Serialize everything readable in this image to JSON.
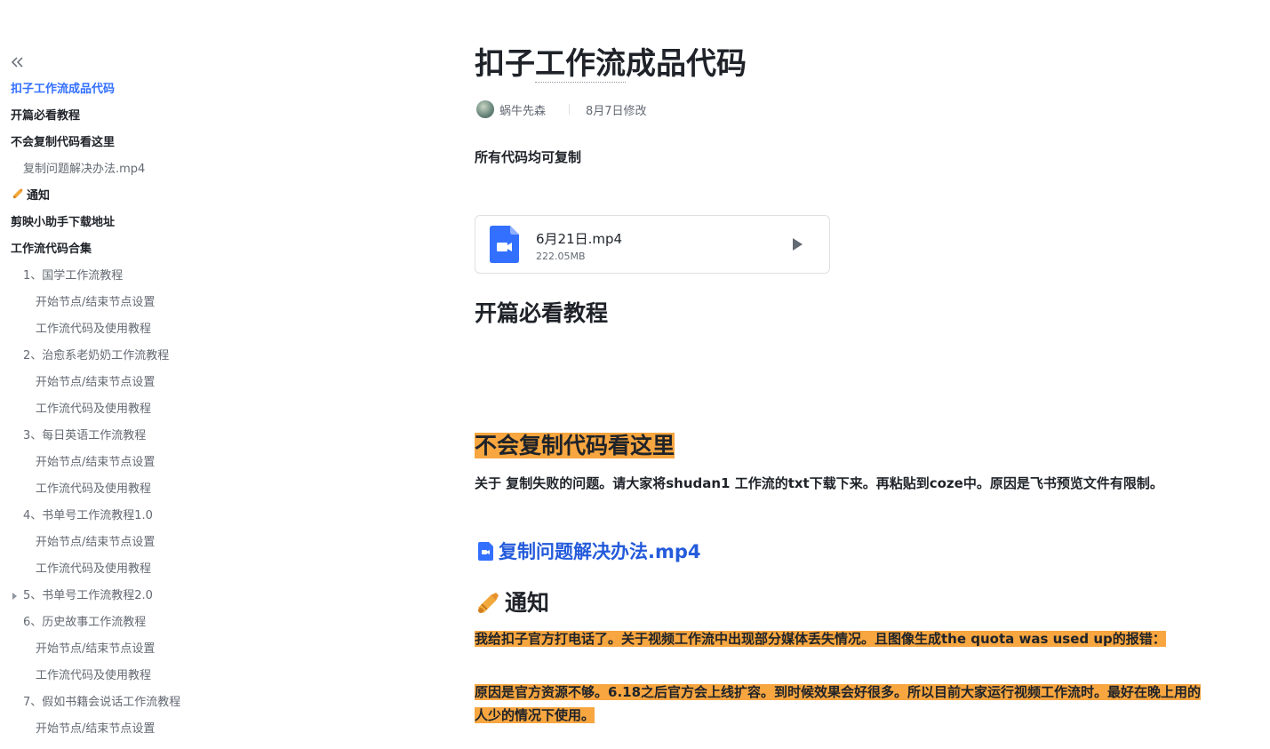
{
  "sidebar": {
    "toc": [
      {
        "label": "扣子工作流成品代码",
        "level": 1,
        "active": true
      },
      {
        "label": "开篇必看教程",
        "level": 1
      },
      {
        "label": "不会复制代码看这里",
        "level": 1
      },
      {
        "label": "复制问题解决办法.mp4",
        "level": 2
      },
      {
        "label": "通知",
        "level": 1,
        "icon": "trumpet-icon"
      },
      {
        "label": "剪映小助手下载地址",
        "level": 1
      },
      {
        "label": "工作流代码合集",
        "level": 1
      },
      {
        "label": "1、国学工作流教程",
        "level": 2
      },
      {
        "label": "开始节点/结束节点设置",
        "level": 3
      },
      {
        "label": "工作流代码及使用教程",
        "level": 3
      },
      {
        "label": "2、治愈系老奶奶工作流教程",
        "level": 2
      },
      {
        "label": "开始节点/结束节点设置",
        "level": 3
      },
      {
        "label": "工作流代码及使用教程",
        "level": 3
      },
      {
        "label": "3、每日英语工作流教程",
        "level": 2
      },
      {
        "label": "开始节点/结束节点设置",
        "level": 3
      },
      {
        "label": "工作流代码及使用教程",
        "level": 3
      },
      {
        "label": "4、书单号工作流教程1.0",
        "level": 2
      },
      {
        "label": "开始节点/结束节点设置",
        "level": 3
      },
      {
        "label": "工作流代码及使用教程",
        "level": 3
      },
      {
        "label": "5、书单号工作流教程2.0",
        "level": 2,
        "collapsed": true
      },
      {
        "label": "6、历史故事工作流教程",
        "level": 2
      },
      {
        "label": "开始节点/结束节点设置",
        "level": 3
      },
      {
        "label": "工作流代码及使用教程",
        "level": 3
      },
      {
        "label": "7、假如书籍会说话工作流教程",
        "level": 2
      },
      {
        "label": "开始节点/结束节点设置",
        "level": 3
      }
    ]
  },
  "doc": {
    "title": "扣子工作流成品代码",
    "author": "蜗牛先森",
    "modified": "8月7日修改",
    "intro": "所有代码均可复制",
    "file": {
      "name": "6月21日.mp4",
      "size": "222.05MB"
    },
    "h_tutorial": "开篇必看教程",
    "h_copy": "不会复制代码看这里",
    "copy_para": "关于 复制失败的问题。请大家将shudan1 工作流的txt下载下来。再粘贴到coze中。原因是飞书预览文件有限制。",
    "copy_link": "复制问题解决办法.mp4",
    "h_notice": "通知",
    "notice_1": "我给扣子官方打电话了。关于视频工作流中出现部分媒体丢失情况。且图像生成the quota was used up的报错：",
    "notice_2": "原因是官方资源不够。6.18之后官方会上线扩容。到时候效果会好很多。所以目前大家运行视频工作流时。最好在晚上用的人少的情况下使用。"
  },
  "colors": {
    "accent": "#3370ff",
    "highlight": "#f7a640",
    "link": "#245bdb",
    "video_icon": "#3370ff"
  }
}
